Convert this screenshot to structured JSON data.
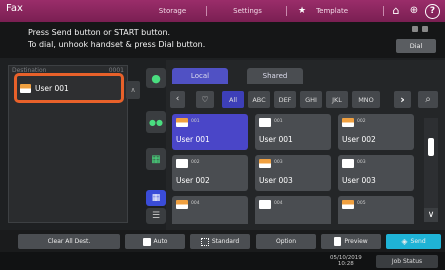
{
  "app": {
    "title": "Fax"
  },
  "topnav": {
    "storage": "Storage",
    "settings": "Settings",
    "template": "Template"
  },
  "info": {
    "line1": "Press Send button or START button.",
    "line2": "To dial, unhook handset & press Dial button.",
    "dial": "Dial"
  },
  "destination": {
    "header_label": "Destination",
    "header_count": "0001",
    "item": "User 001"
  },
  "tabs": {
    "local": "Local",
    "shared": "Shared"
  },
  "filters": [
    "All",
    "ABC",
    "DEF",
    "GHI",
    "JKL",
    "MNO"
  ],
  "contacts": [
    {
      "num": "001",
      "name": "User 001",
      "type": "fax",
      "selected": true
    },
    {
      "num": "001",
      "name": "User 001",
      "type": "email",
      "selected": false
    },
    {
      "num": "002",
      "name": "User 002",
      "type": "fax",
      "selected": false
    },
    {
      "num": "002",
      "name": "User 002",
      "type": "email",
      "selected": false
    },
    {
      "num": "003",
      "name": "User 003",
      "type": "fax",
      "selected": false
    },
    {
      "num": "003",
      "name": "User 003",
      "type": "email",
      "selected": false
    },
    {
      "num": "004",
      "name": "",
      "type": "fax",
      "selected": false
    },
    {
      "num": "004",
      "name": "",
      "type": "email",
      "selected": false
    },
    {
      "num": "005",
      "name": "",
      "type": "fax",
      "selected": false
    }
  ],
  "bottom": {
    "clear": "Clear All Dest.",
    "auto": "Auto",
    "standard": "Standard",
    "option": "Option",
    "preview": "Preview",
    "send": "Send"
  },
  "footer": {
    "date": "05/10/2019",
    "time": "10:28",
    "job_status": "Job Status"
  },
  "colors": {
    "accent": "#9a2d6a",
    "highlight": "#e8612a",
    "selected": "#4a46c8",
    "send": "#1fb3d6"
  }
}
